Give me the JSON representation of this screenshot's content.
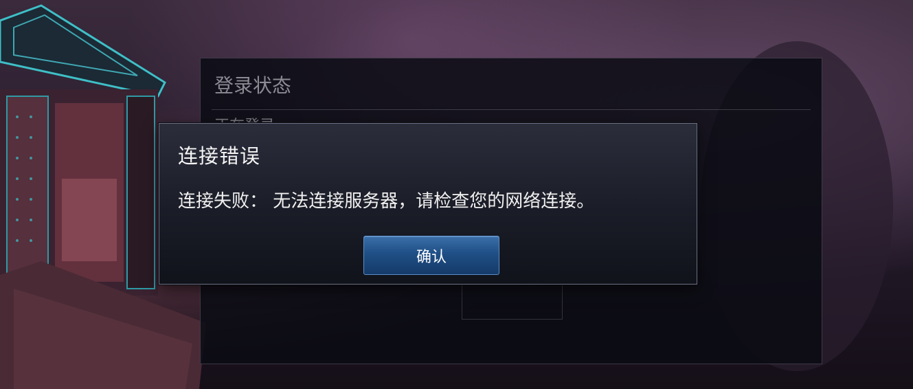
{
  "background_panel": {
    "title": "登录状态",
    "subtitle": "正在登录..."
  },
  "dialog": {
    "title": "连接错误",
    "message": "连接失败： 无法连接服务器，请检查您的网络连接。",
    "confirm_label": "确认"
  },
  "colors": {
    "dialog_bg": "#1a1c27",
    "button_blue": "#1f4f86",
    "text": "#f4f4f4"
  }
}
